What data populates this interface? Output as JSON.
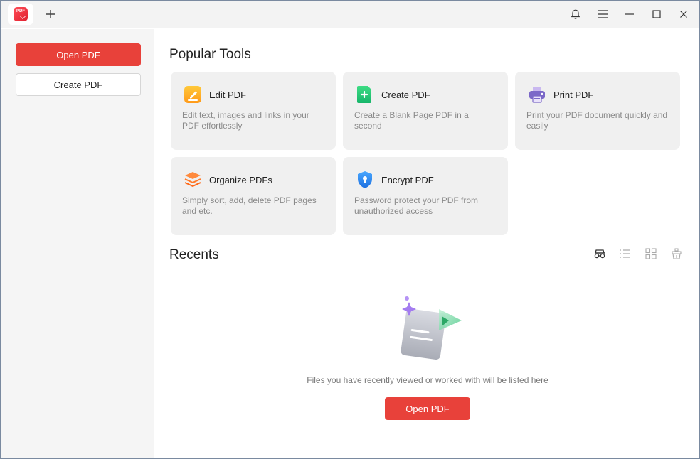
{
  "titlebar": {
    "app_logo_text": "PDF",
    "icons": [
      "bell-icon",
      "menu-icon",
      "minimize-icon",
      "maximize-icon",
      "close-icon"
    ]
  },
  "sidebar": {
    "open_label": "Open PDF",
    "create_label": "Create PDF"
  },
  "main": {
    "popular_title": "Popular Tools",
    "tools": [
      {
        "title": "Edit PDF",
        "desc": "Edit text, images and links in your PDF effortlessly",
        "icon": "edit-pdf-icon"
      },
      {
        "title": "Create PDF",
        "desc": "Create a Blank Page PDF in a second",
        "icon": "create-pdf-icon"
      },
      {
        "title": "Print PDF",
        "desc": "Print your PDF document quickly and easily",
        "icon": "printer-icon"
      },
      {
        "title": "Organize PDFs",
        "desc": "Simply sort, add, delete PDF pages and etc.",
        "icon": "layers-icon"
      },
      {
        "title": "Encrypt PDF",
        "desc": "Password protect your PDF from unauthorized access",
        "icon": "shield-lock-icon"
      }
    ],
    "recents_title": "Recents",
    "view_icons": [
      "glasses-icon",
      "list-view-icon",
      "grid-view-icon",
      "clear-icon"
    ],
    "empty_text": "Files you have recently viewed or worked with will be listed here",
    "open_label": "Open PDF"
  },
  "colors": {
    "accent": "#e8413a",
    "sidebar_bg": "#f5f5f5",
    "card_bg": "#f0f0f0"
  }
}
